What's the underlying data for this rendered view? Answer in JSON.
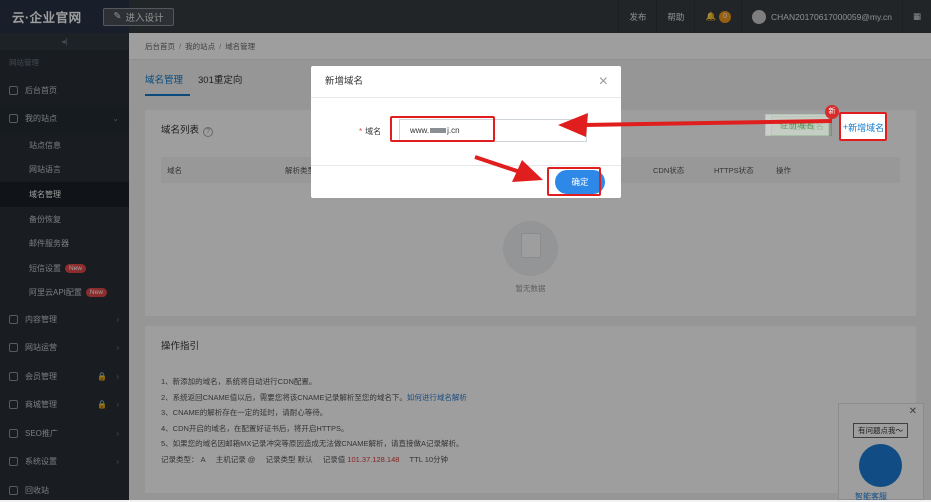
{
  "topbar": {
    "logo": "云·企业官网",
    "enter_design": "进入设计",
    "publish": "发布",
    "help": "帮助",
    "notify_count": "0",
    "user": "CHAN20170617000059@my.cn"
  },
  "sidebar": {
    "collapse": "◂|",
    "section": "网站管理",
    "items": {
      "home": "后台首页",
      "sites": "我的站点",
      "content": "内容管理",
      "ops": "网站运营",
      "member": "会员管理",
      "mall": "商城管理",
      "seo": "SEO推广",
      "settings": "系统设置",
      "recycle": "回收站"
    },
    "subs": [
      "站点信息",
      "网站语言",
      "域名管理",
      "备份恢复",
      "邮件服务器",
      "短信设置",
      "阿里云API配置"
    ],
    "new_badge": "New"
  },
  "breadcrumb": [
    "后台首页",
    "我的站点",
    "域名管理"
  ],
  "tabs": [
    "域名管理",
    "301重定向"
  ],
  "panel": {
    "title": "域名列表",
    "register_btn": "注册域名",
    "add_btn": "新增域名",
    "red_badge": "新",
    "columns": [
      "域名",
      "解析类型",
      "",
      "",
      "",
      "",
      "CDN状态",
      "HTTPS状态",
      "操作"
    ],
    "empty": "暂无数据"
  },
  "guide": {
    "title": "操作指引",
    "lines": [
      "1、新添加的域名，系统将自动进行CDN配置。",
      "2、系统返回CNAME值以后，需要您将该CNAME记录解析至您的域名下。",
      "3、CNAME的解析存在一定的延时，请耐心等待。",
      "4、CDN开启的域名，在配置好证书后，将开启HTTPS。",
      "5、如果您的域名因邮箱MX记录冲突等原因造成无法做CNAME解析，请直接做A记录解析。"
    ],
    "link": "如何进行域名解析",
    "record": [
      "记录类型：",
      "A",
      "主机记录",
      "@",
      "记录类型",
      "默认",
      "记录值",
      "101.37.128.148",
      "TTL",
      "10分钟"
    ]
  },
  "modal": {
    "title": "新增域名",
    "label": "域名",
    "value": "www.",
    "value_suffix": "j.cn",
    "ok": "确定"
  },
  "float": {
    "question": "有问题点我～",
    "label": "智能客服"
  }
}
